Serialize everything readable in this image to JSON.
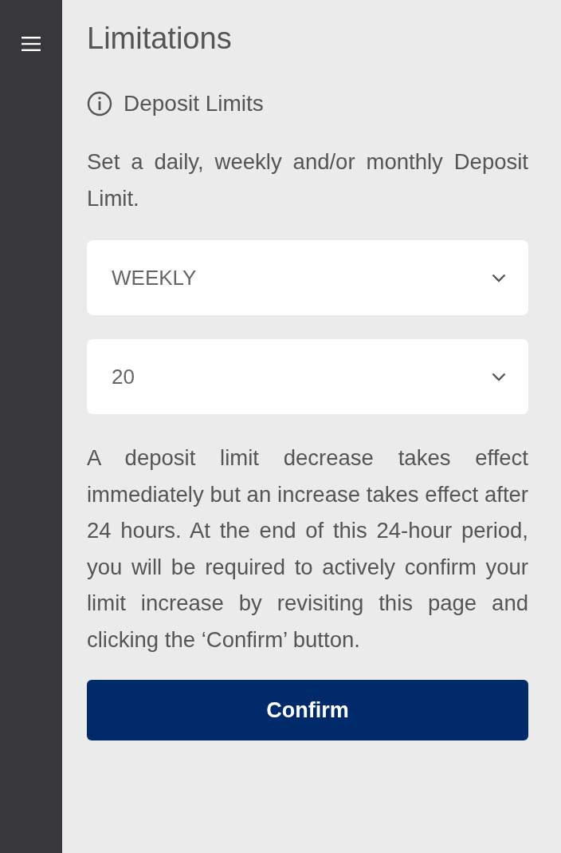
{
  "title": "Limitations",
  "section": {
    "heading": "Deposit Limits",
    "intro": "Set a daily, weekly and/or monthly Deposit Limit."
  },
  "selects": [
    {
      "value": "WEEKLY"
    },
    {
      "value": "20"
    }
  ],
  "notice": "A deposit limit decrease takes effect immediately but an increase takes effect after 24 hours. At the end of this 24-hour period, you will be required to actively confirm your limit increase by revisiting this page and clicking the ‘Confirm’ button.",
  "button": "Confirm"
}
